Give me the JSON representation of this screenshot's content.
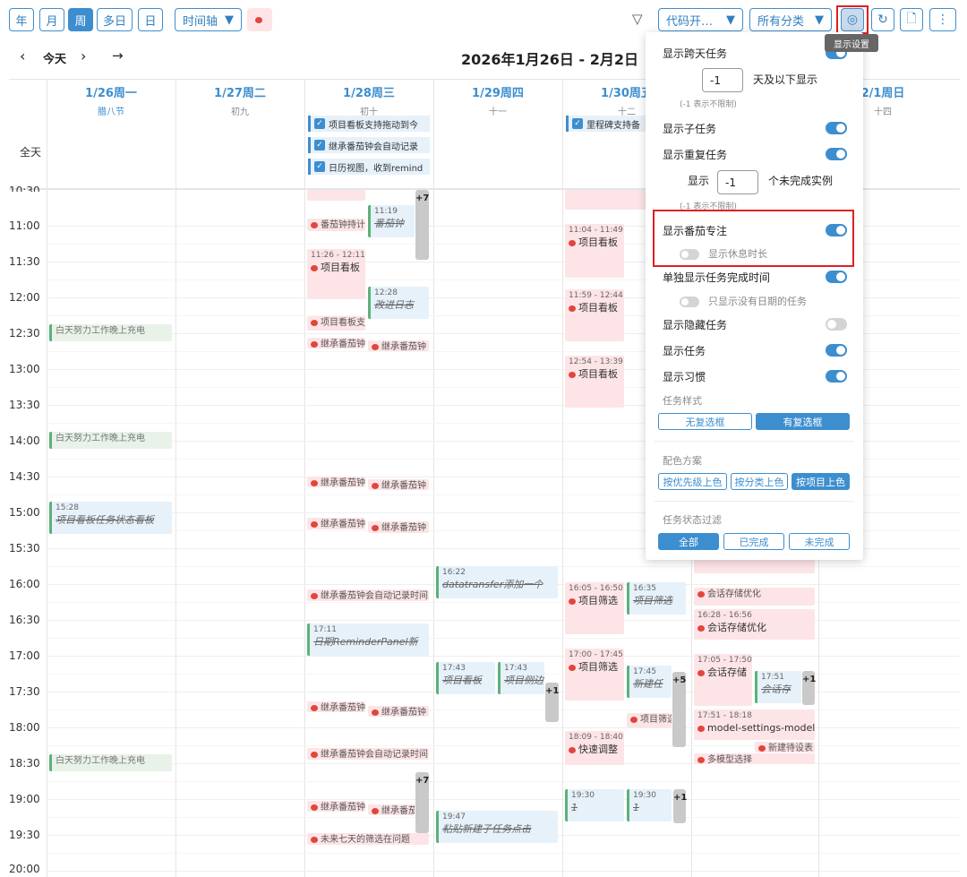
{
  "toolbar": {
    "views": [
      "年",
      "月",
      "周",
      "多日",
      "日"
    ],
    "timeline_label": "时间轴",
    "filter1": "代码开…",
    "filter2": "所有分类",
    "tooltip": "显示设置"
  },
  "nav": {
    "today": "今天",
    "range": "2026年1月26日 - 2月2日"
  },
  "days": [
    {
      "date": "1/26周一",
      "lunar": "腊八节"
    },
    {
      "date": "1/27周二",
      "lunar": "初九"
    },
    {
      "date": "1/28周三",
      "lunar": "初十"
    },
    {
      "date": "1/29周四",
      "lunar": "十一"
    },
    {
      "date": "1/30周五",
      "lunar": "十二"
    },
    {
      "date": "",
      "lunar": ""
    },
    {
      "date": "2/1周日",
      "lunar": "十四"
    }
  ],
  "allday_label": "全天",
  "allday_events": [
    "项目看板支持拖动到今",
    "继承番茄钟会自动记录",
    "日历视图，收到remind",
    "里程碑支持备"
  ],
  "times": [
    "10:30",
    "11:00",
    "11:30",
    "12:00",
    "12:30",
    "13:00",
    "13:30",
    "14:00",
    "14:30",
    "15:00",
    "15:30",
    "16:00",
    "16:30",
    "17:00",
    "17:30",
    "18:00",
    "18:30",
    "19:00",
    "19:30",
    "20:00"
  ],
  "events": {
    "habit": "白天努力工作晚上充电",
    "e1519": {
      "time": "15:28",
      "name": "项目看板任务状态看板"
    },
    "p1": "番茄钟持计",
    "e1119": {
      "time": "11:19",
      "name": "番茄钟"
    },
    "e1126": {
      "time": "11:26 - 12:11",
      "name": "项目看板"
    },
    "e1228": {
      "time": "12:28",
      "name": "改进日志"
    },
    "p2": "项目看板支",
    "p3": "继承番茄钟",
    "p4": "继承番茄钟会自动记录时间",
    "e1711": {
      "time": "17:11",
      "name": "日期ReminderPanel新"
    },
    "p5": "未来七天的筛选在问题",
    "e1622": {
      "time": "16:22",
      "name": "datatransfer添加一个"
    },
    "e1743a": {
      "time": "17:43",
      "name": "项目看板"
    },
    "e1743b": {
      "time": "17:43",
      "name": "项目侧边"
    },
    "e1947": {
      "time": "19:47",
      "name": "粘贴新建子任务点击"
    },
    "e1104": {
      "time": "11:04 - 11:49",
      "name": "项目看板"
    },
    "e1159": {
      "time": "11:59 - 12:44",
      "name": "项目看板"
    },
    "e1254": {
      "time": "12:54 - 13:39",
      "name": "项目看板"
    },
    "e1605": {
      "time": "16:05 - 16:50",
      "name": "项目筛选"
    },
    "e1635": {
      "time": "16:35",
      "name": "项目筛选"
    },
    "e1700": {
      "time": "17:00 - 17:45",
      "name": "项目筛选"
    },
    "e1745": {
      "time": "17:45",
      "name": "新建任"
    },
    "p6": "项目筛选",
    "e1809": {
      "time": "18:09 - 18:40",
      "name": "快速调整"
    },
    "e1930a": {
      "time": "19:30",
      "name": "1"
    },
    "e1930b": {
      "time": "19:30",
      "name": "1"
    },
    "p7": "会话存储优化",
    "e1628": {
      "time": "16:28 - 16:56",
      "name": "会话存储优化"
    },
    "e1705": {
      "time": "17:05 - 17:50",
      "name": "会话存储"
    },
    "e1751": {
      "time": "17:51",
      "name": "会话存"
    },
    "e1751b": {
      "time": "17:51 - 18:18",
      "name": "model-settings-model-l"
    },
    "p8": "新建待设表",
    "p9": "多模型选择",
    "more": [
      "+7",
      "+1",
      "+5",
      "+1",
      "+7",
      "+1"
    ]
  },
  "panel": {
    "cross_day": "显示跨天任务",
    "cross_val": "-1",
    "cross_suffix": "天及以下显示",
    "cross_hint": "(-1 表示不限制)",
    "subtask": "显示子任务",
    "repeat": "显示重复任务",
    "show": "显示",
    "repeat_val": "-1",
    "repeat_suffix": "个未完成实例",
    "repeat_hint": "(-1 表示不限制)",
    "pomodoro": "显示番茄专注",
    "rest": "显示休息时长",
    "separate": "单独显示任务完成时间",
    "nodate": "只显示没有日期的任务",
    "hidden": "显示隐藏任务",
    "tasks": "显示任务",
    "habits": "显示习惯",
    "style_title": "任务样式",
    "style_opts": [
      "无复选框",
      "有复选框"
    ],
    "color_title": "配色方案",
    "color_opts": [
      "按优先级上色",
      "按分类上色",
      "按项目上色"
    ],
    "status_title": "任务状态过滤",
    "status_opts": [
      "全部",
      "已完成",
      "未完成"
    ]
  },
  "colors": {
    "accent": "#3d8ecf",
    "highlight": "#e02020",
    "pomodoro_bg": "#fde4e6"
  }
}
